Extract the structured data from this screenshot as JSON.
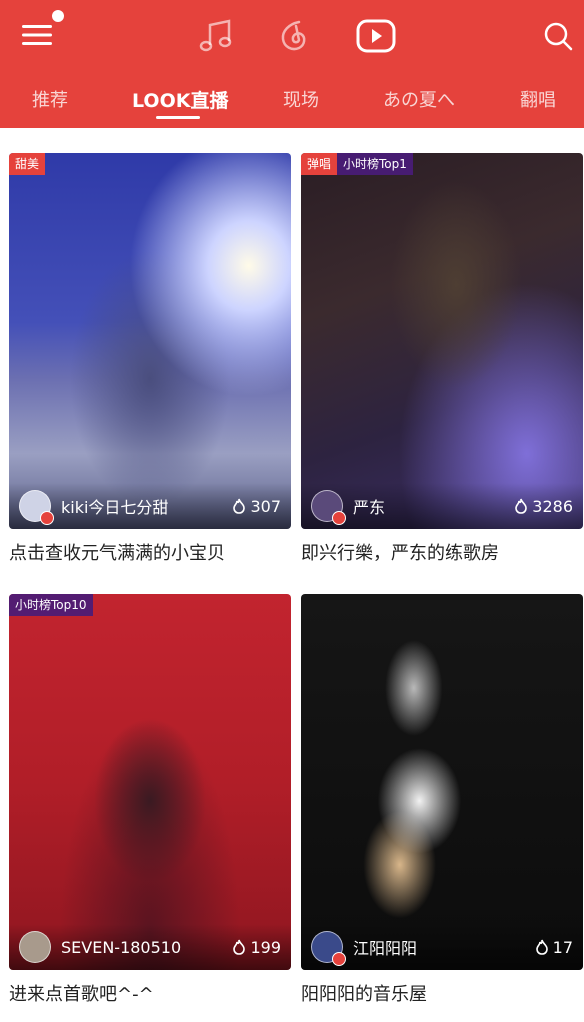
{
  "header": {
    "icons": [
      "menu-icon",
      "music-note-icon",
      "radio-icon",
      "video-play-icon",
      "search-icon"
    ],
    "tabs": [
      {
        "label": "推荐"
      },
      {
        "label": "LOOK直播"
      },
      {
        "label": "现场"
      },
      {
        "label": "あの夏へ"
      },
      {
        "label": "翻唱"
      }
    ],
    "active_tab": "LOOK直播",
    "accent_color": "#e5423c"
  },
  "cards": [
    {
      "tags": [
        "甜美"
      ],
      "anchor": "kiki今日七分甜",
      "heat": "307",
      "caption": "点击查收元气满满的小宝贝"
    },
    {
      "tags": [
        "弹唱",
        "小时榜Top1"
      ],
      "anchor": "严东",
      "heat": "3286",
      "caption": "即兴行樂，严东的练歌房"
    },
    {
      "tags": [
        "小时榜Top10"
      ],
      "anchor": "SEVEN-180510",
      "heat": "199",
      "caption": "进来点首歌吧^-^"
    },
    {
      "tags": [],
      "anchor": "江阳阳阳",
      "heat": "17",
      "caption": "阳阳阳的音乐屋"
    }
  ]
}
